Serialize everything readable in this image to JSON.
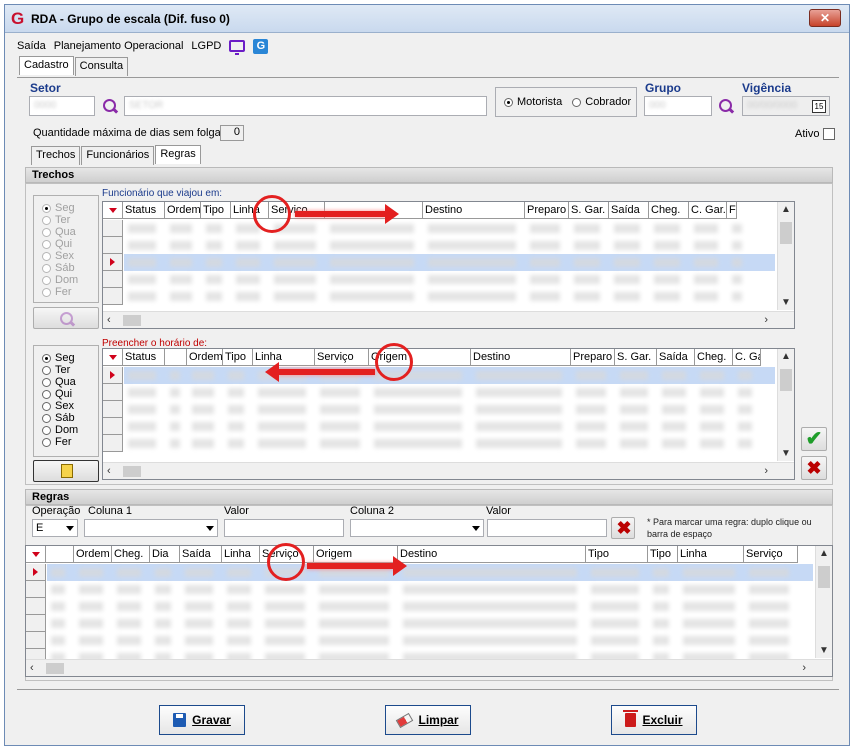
{
  "window": {
    "title": "RDA - Grupo de escala (Dif. fuso 0)",
    "close_label": "✕"
  },
  "menu": {
    "items": [
      "Saída",
      "Planejamento Operacional",
      "LGPD"
    ]
  },
  "top_tabs": [
    "Cadastro",
    "Consulta"
  ],
  "header": {
    "setor_label": "Setor",
    "radio_motorista": "Motorista",
    "radio_cobrador": "Cobrador",
    "grupo_label": "Grupo",
    "vigencia_label": "Vigência",
    "calendar_label": "15",
    "qty_label": "Quantidade máxima de dias sem folga",
    "qty_value": "0",
    "ativo_label": "Ativo"
  },
  "inner_tabs": [
    "Trechos",
    "Funcionários",
    "Regras"
  ],
  "trechos": {
    "section_title": "Trechos",
    "grid1_caption": "Funcionário que viajou em:",
    "grid1_columns": [
      "Status",
      "Ordem",
      "Tipo",
      "Linha",
      "Serviço",
      "",
      "Destino",
      "Preparo",
      "S. Gar.",
      "Saída",
      "Cheg.",
      "C. Gar.",
      "F"
    ],
    "grid2_caption": "Preencher o horário de:",
    "grid2_columns": [
      "Status",
      "",
      "Ordem",
      "Tipo",
      "Linha",
      "Serviço",
      "Origem",
      "Destino",
      "Preparo",
      "S. Gar.",
      "Saída",
      "Cheg.",
      "C. Ga"
    ],
    "days": [
      "Seg",
      "Ter",
      "Qua",
      "Qui",
      "Sex",
      "Sáb",
      "Dom",
      "Fer"
    ]
  },
  "regras": {
    "section_title": "Regras",
    "op_label": "Operação",
    "op_value": "E",
    "col1_label": "Coluna 1",
    "valor1_label": "Valor",
    "col2_label": "Coluna 2",
    "valor2_label": "Valor",
    "note": "* Para marcar uma regra: duplo clique ou barra de espaço",
    "grid_columns": [
      "",
      "Ordem",
      "Cheg.",
      "Dia",
      "Saída",
      "Linha",
      "Serviço",
      "Origem",
      "Destino",
      "Tipo",
      "Tipo",
      "Linha",
      "Serviço"
    ]
  },
  "footer": {
    "save_label": "Gravar",
    "clear_label": "Limpar",
    "delete_label": "Excluir"
  },
  "colors": {
    "accent": "#1b3b8c",
    "brand": "#c8102e",
    "selection": "#c6d9f5",
    "annotation": "#e32020"
  }
}
